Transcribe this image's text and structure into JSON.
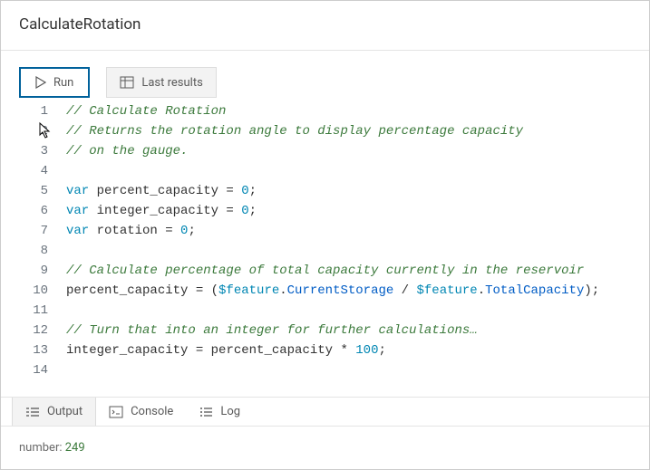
{
  "header": {
    "title": "CalculateRotation"
  },
  "toolbar": {
    "run_label": "Run",
    "last_results_label": "Last results"
  },
  "editor": {
    "lines": [
      {
        "n": 1,
        "tokens": [
          {
            "t": "// Calculate Rotation",
            "c": "comment"
          }
        ]
      },
      {
        "n": 2,
        "tokens": [
          {
            "t": "// Returns the rotation angle to display percentage capacity",
            "c": "comment"
          }
        ]
      },
      {
        "n": 3,
        "tokens": [
          {
            "t": "// on the gauge.",
            "c": "comment"
          }
        ]
      },
      {
        "n": 4,
        "tokens": []
      },
      {
        "n": 5,
        "tokens": [
          {
            "t": "var ",
            "c": "keyword"
          },
          {
            "t": "percent_capacity",
            "c": "ident"
          },
          {
            "t": " = ",
            "c": "punct"
          },
          {
            "t": "0",
            "c": "number"
          },
          {
            "t": ";",
            "c": "punct"
          }
        ]
      },
      {
        "n": 6,
        "tokens": [
          {
            "t": "var ",
            "c": "keyword"
          },
          {
            "t": "integer_capacity",
            "c": "ident"
          },
          {
            "t": " = ",
            "c": "punct"
          },
          {
            "t": "0",
            "c": "number"
          },
          {
            "t": ";",
            "c": "punct"
          }
        ]
      },
      {
        "n": 7,
        "tokens": [
          {
            "t": "var ",
            "c": "keyword"
          },
          {
            "t": "rotation",
            "c": "ident"
          },
          {
            "t": " = ",
            "c": "punct"
          },
          {
            "t": "0",
            "c": "number"
          },
          {
            "t": ";",
            "c": "punct"
          }
        ]
      },
      {
        "n": 8,
        "tokens": []
      },
      {
        "n": 9,
        "tokens": [
          {
            "t": "// Calculate percentage of total capacity currently in the reservoir",
            "c": "comment"
          }
        ]
      },
      {
        "n": 10,
        "tokens": [
          {
            "t": "percent_capacity",
            "c": "ident"
          },
          {
            "t": " = (",
            "c": "punct"
          },
          {
            "t": "$feature",
            "c": "keyword"
          },
          {
            "t": ".",
            "c": "punct"
          },
          {
            "t": "CurrentStorage",
            "c": "prop"
          },
          {
            "t": " / ",
            "c": "punct"
          },
          {
            "t": "$feature",
            "c": "keyword"
          },
          {
            "t": ".",
            "c": "punct"
          },
          {
            "t": "TotalCapacity",
            "c": "prop"
          },
          {
            "t": ");",
            "c": "punct"
          }
        ]
      },
      {
        "n": 11,
        "tokens": []
      },
      {
        "n": 12,
        "tokens": [
          {
            "t": "// Turn that into an integer for further calculations…",
            "c": "comment"
          }
        ]
      },
      {
        "n": 13,
        "tokens": [
          {
            "t": "integer_capacity",
            "c": "ident"
          },
          {
            "t": " = ",
            "c": "punct"
          },
          {
            "t": "percent_capacity",
            "c": "ident"
          },
          {
            "t": " * ",
            "c": "punct"
          },
          {
            "t": "100",
            "c": "number"
          },
          {
            "t": ";",
            "c": "punct"
          }
        ]
      },
      {
        "n": 14,
        "tokens": []
      }
    ]
  },
  "bottom_tabs": {
    "output_label": "Output",
    "console_label": "Console",
    "log_label": "Log"
  },
  "output": {
    "label": "number: ",
    "value": "249"
  }
}
